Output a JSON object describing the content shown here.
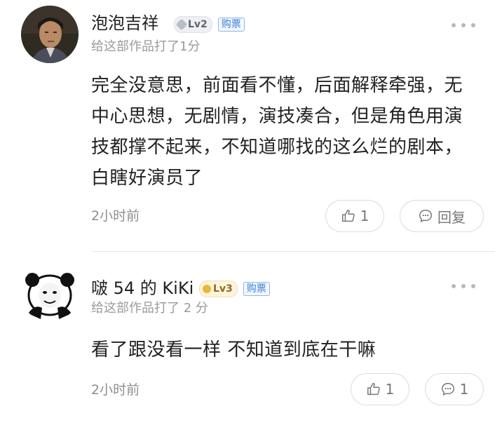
{
  "comments": [
    {
      "username": "泡泡吉祥",
      "level": "Lv2",
      "ticket": "购票",
      "subtitle": "给这部作品打了1分",
      "text": "完全没意思，前面看不懂，后面解释牵强，无中心思想，无剧情，演技凑合，但是角色用演技都撑不起来，不知道哪找的这么烂的剧本，白瞎好演员了",
      "time": "2小时前",
      "likes": "1",
      "reply_label": "回复",
      "avatar_icon": "user-photo-avatar",
      "colors": {
        "level_badge": "#b8bec8"
      }
    },
    {
      "username": "啵 54 的 KiKi",
      "level": "Lv3",
      "ticket": "购票",
      "subtitle": "给这部作品打了 2 分",
      "text": "看了跟没看一样 不知道到底在干嘛",
      "time": "2小时前",
      "likes": "1",
      "replies": "1",
      "avatar_icon": "panda-meme-avatar",
      "colors": {
        "level_badge": "#e9b73d"
      }
    }
  ],
  "colors": {
    "ticket": "#3a7fd5",
    "secondary_text": "#9a9a9a"
  }
}
